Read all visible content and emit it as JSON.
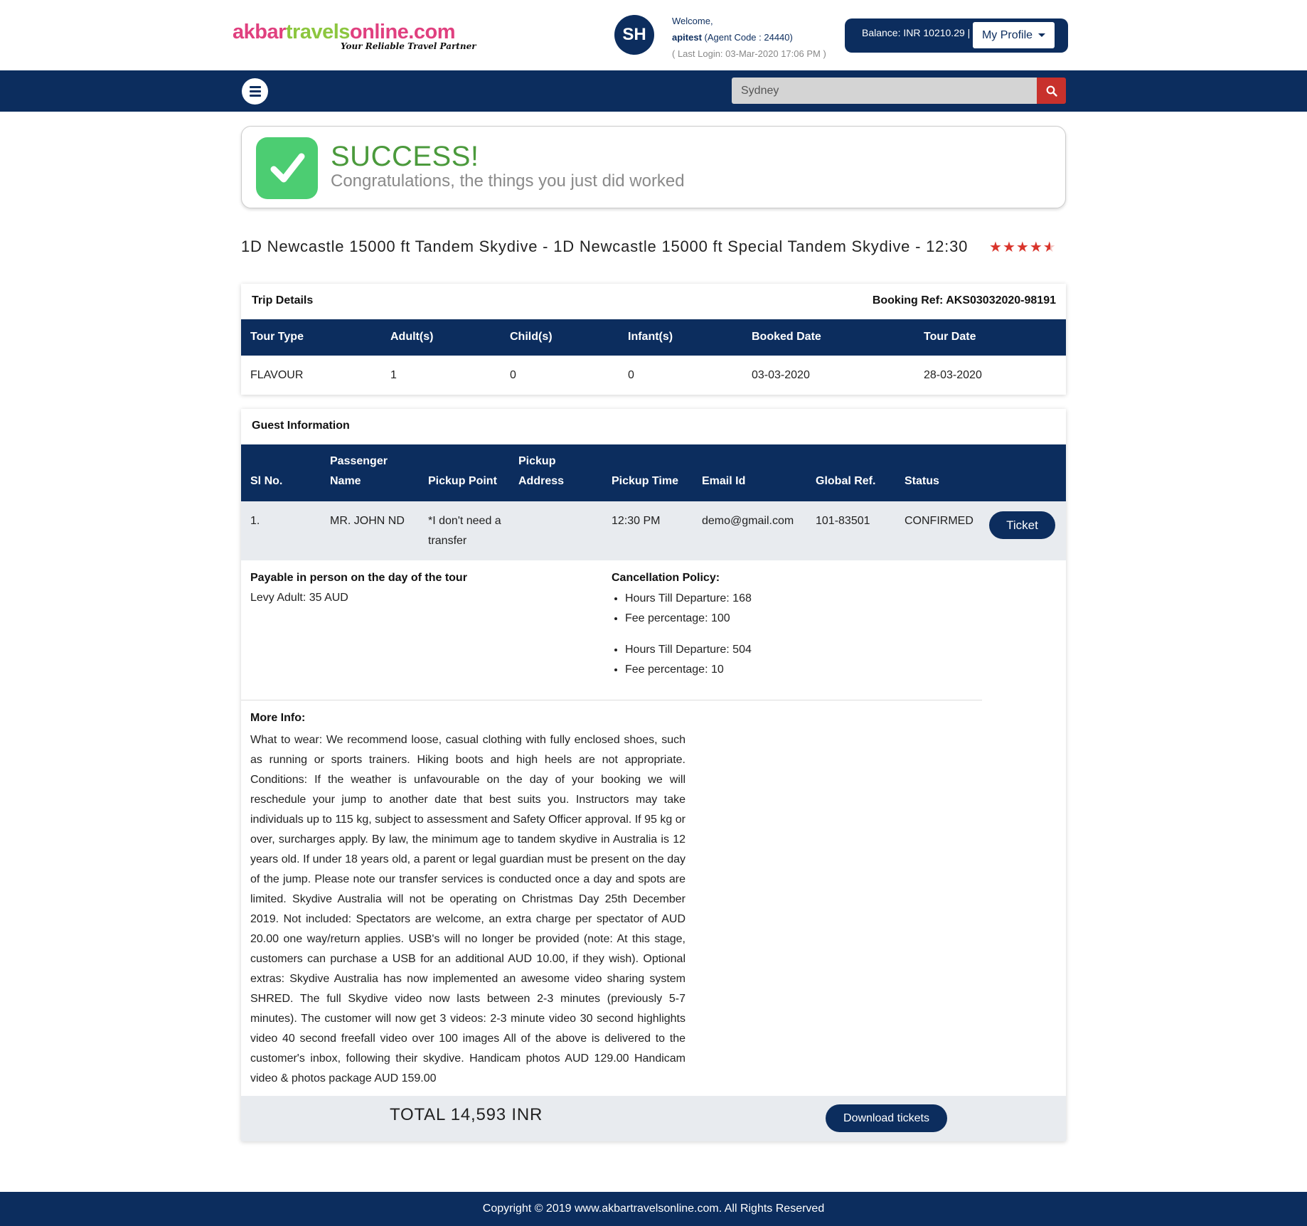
{
  "header": {
    "logo_part1": "akbar",
    "logo_part2": "travels",
    "logo_part3": "online.com",
    "logo_tagline": "Your Reliable Travel Partner",
    "avatar_initials": "SH",
    "welcome_label": "Welcome,",
    "username": "apitest",
    "agent_code": "(Agent Code : 24440)",
    "last_login": "( Last Login: 03-Mar-2020 17:06 PM )",
    "balance": "Balance: INR 10210.29 |",
    "profile_label": "My Profile"
  },
  "nav": {
    "search_value": "Sydney",
    "search_placeholder": "Sydney"
  },
  "success": {
    "title": "SUCCESS!",
    "subtitle": "Congratulations, the things you just did worked"
  },
  "tour": {
    "title": "1D Newcastle 15000 ft Tandem Skydive - 1D Newcastle 15000 ft Special Tandem Skydive - 12:30",
    "rating": 4.5
  },
  "trip_details": {
    "heading": "Trip Details",
    "booking_ref": "Booking Ref: AKS03032020-98191",
    "columns": [
      "Tour Type",
      "Adult(s)",
      "Child(s)",
      "Infant(s)",
      "Booked Date",
      "Tour Date"
    ],
    "row": [
      "FLAVOUR",
      "1",
      "0",
      "0",
      "03-03-2020",
      "28-03-2020"
    ]
  },
  "guest_info": {
    "heading": "Guest Information",
    "columns": {
      "sl_no": "Sl No.",
      "passenger_line1": "Passenger",
      "passenger_line2": "Name",
      "pickup_point": "Pickup Point",
      "pickup_address_line1": "Pickup",
      "pickup_address_line2": "Address",
      "pickup_time": "Pickup Time",
      "email": "Email Id",
      "global_ref": "Global Ref.",
      "status": "Status"
    },
    "row": {
      "sl_no": "1.",
      "passenger": "MR. JOHN ND",
      "pickup_point_line1": "*I don't need a",
      "pickup_point_line2": "transfer",
      "pickup_address": "",
      "pickup_time": "12:30 PM",
      "email": "demo@gmail.com",
      "global_ref": "101-83501",
      "status": "CONFIRMED",
      "ticket_label": "Ticket"
    },
    "payable_title": "Payable in person on the day of the tour",
    "payable_value": "Levy Adult: 35 AUD",
    "cancellation_title": "Cancellation Policy:",
    "cancellation": [
      {
        "hours": "Hours Till Departure: 168",
        "fee": "Fee percentage: 100"
      },
      {
        "hours": "Hours Till Departure: 504",
        "fee": "Fee percentage: 10"
      }
    ],
    "more_info_title": "More Info:",
    "more_info_text": "What to wear: We recommend loose, casual clothing with fully enclosed shoes, such as running or sports trainers. Hiking boots and high heels are not appropriate. Conditions: If the weather is unfavourable on the day of your booking we will reschedule your jump to another date that best suits you. Instructors may take individuals up to 115 kg, subject to assessment and Safety Officer approval. If 95 kg or over, surcharges apply. By law, the minimum age to tandem skydive in Australia is 12 years old. If under 18 years old, a parent or legal guardian must be present on the day of the jump. Please note our transfer services is conducted once a day and spots are limited. Skydive Australia will not be operating on Christmas Day 25th December 2019. Not included: Spectators are welcome, an extra charge per spectator of AUD 20.00 one way/return applies. USB's will no longer be provided (note: At this stage, customers can purchase a USB for an additional AUD 10.00, if they wish). Optional extras: Skydive Australia has now implemented an awesome video sharing system SHRED. The full Skydive video now lasts between 2-3 minutes (previously 5-7 minutes). The customer will now get 3 videos: 2-3 minute video 30 second highlights video 40 second freefall video over 100 images All of the above is delivered to the customer's inbox, following their skydive. Handicam photos AUD 129.00 Handicam video & photos package AUD 159.00",
    "total": "TOTAL 14,593 INR",
    "download_label": "Download tickets"
  },
  "footer": {
    "copyright": "Copyright © 2019 www.akbartravelsonline.com. All Rights Reserved"
  },
  "colors": {
    "primary_navy": "#0c2d5e",
    "search_red": "#c8312c",
    "success_green": "#4b9a3c",
    "check_green": "#4ccd72",
    "logo_pink": "#e0407f",
    "logo_green": "#8cc63f",
    "star_red": "#d9342b"
  },
  "icons": {
    "menu": "hamburger-icon",
    "search": "search-icon",
    "success": "check-icon",
    "rating": "star-icon"
  }
}
